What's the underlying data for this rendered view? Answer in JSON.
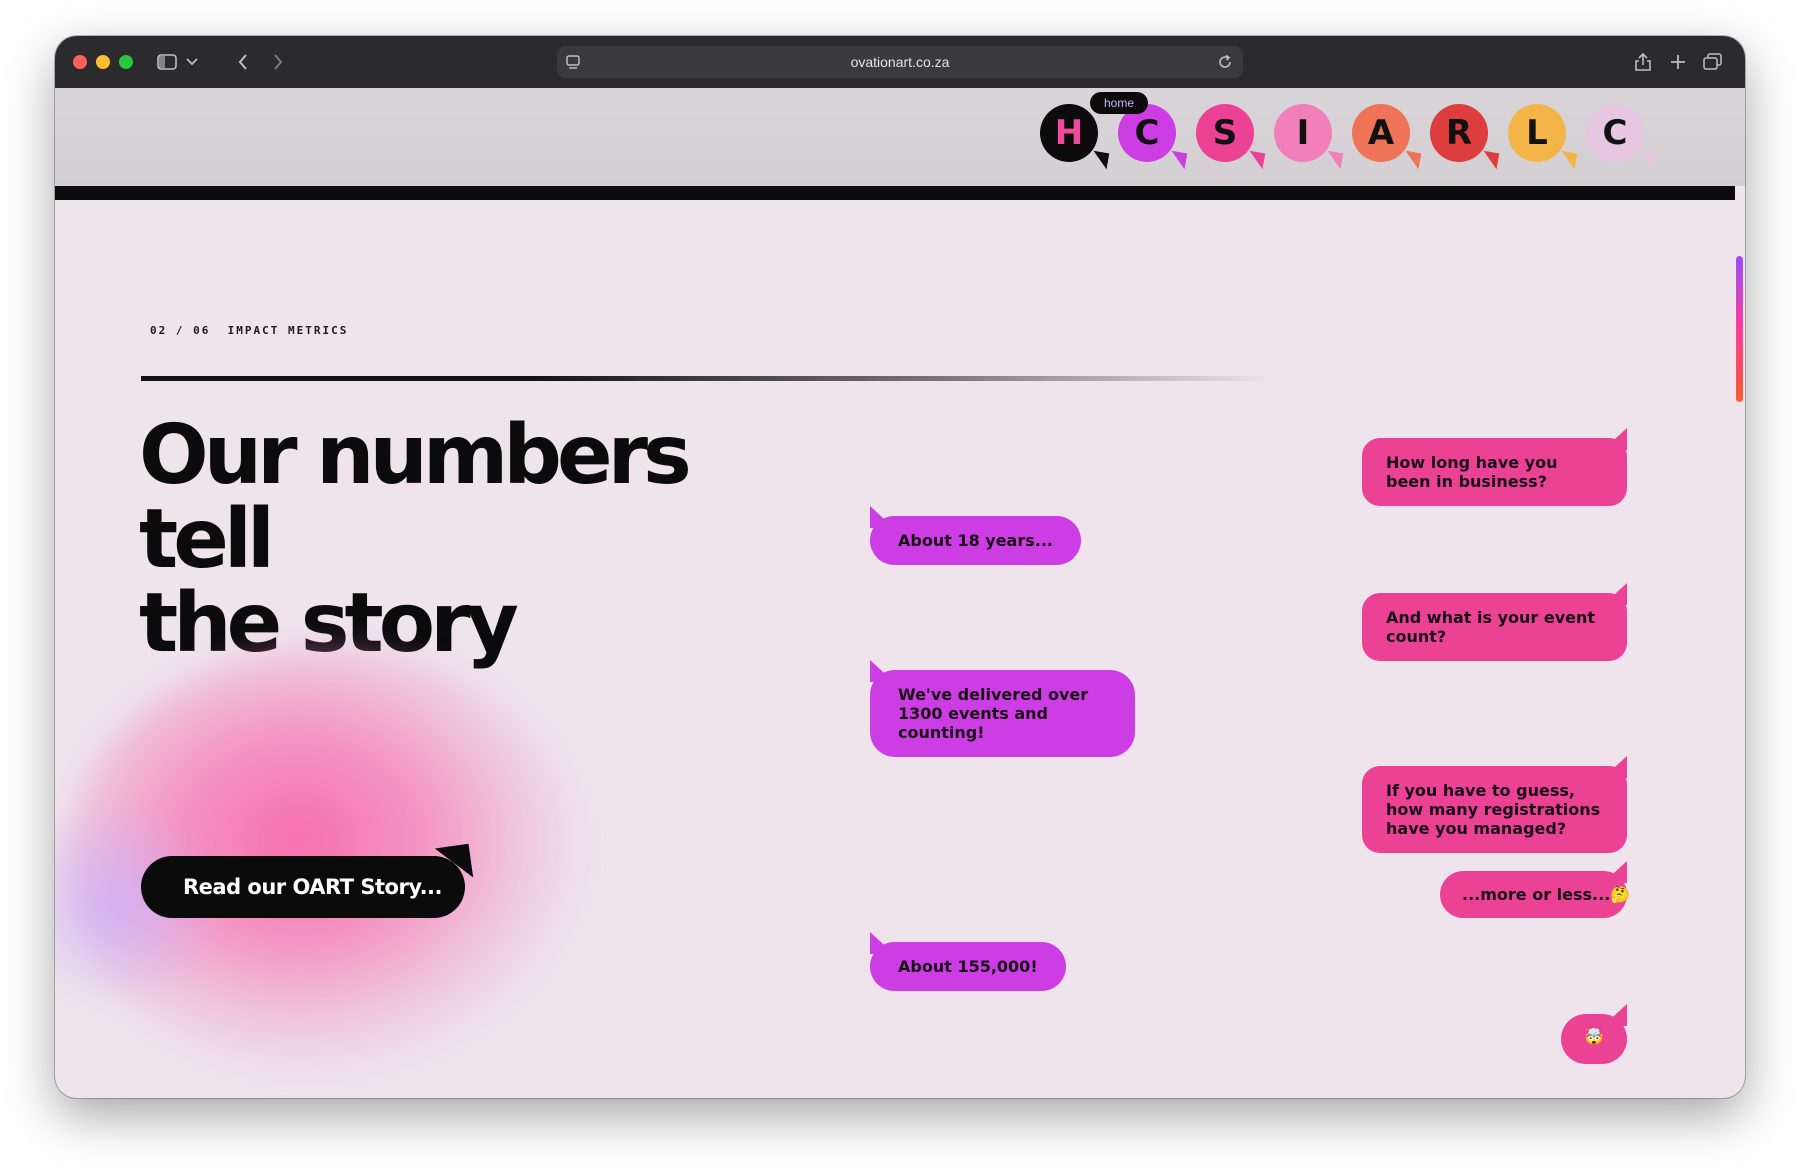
{
  "browser": {
    "url": "ovationart.co.za"
  },
  "nav": {
    "tooltip": "home",
    "items": [
      {
        "letter": "H",
        "color": "#0b0b0b",
        "text_color": "#f04a9c"
      },
      {
        "letter": "C",
        "color": "#cc3ee3",
        "text_color": "#111111"
      },
      {
        "letter": "S",
        "color": "#eb4296",
        "text_color": "#111111"
      },
      {
        "letter": "I",
        "color": "#f17fb9",
        "text_color": "#111111"
      },
      {
        "letter": "A",
        "color": "#ee7357",
        "text_color": "#111111"
      },
      {
        "letter": "R",
        "color": "#de3d3d",
        "text_color": "#111111"
      },
      {
        "letter": "L",
        "color": "#f4b548",
        "text_color": "#111111"
      },
      {
        "letter": "C",
        "color": "#e6c6e0",
        "text_color": "#111111"
      }
    ]
  },
  "section": {
    "label": "02 / 06  IMPACT METRICS",
    "headline_line1": "Our numbers tell",
    "headline_line2": "the story",
    "cta_label": "Read our OART Story..."
  },
  "chat": {
    "q1": "How long have you been in business?",
    "a1": "About 18 years...",
    "q2": "And what is your event count?",
    "a2": "We've delivered over 1300 events and counting!",
    "q3": "If you have to guess, how many registrations have you managed?",
    "q3b": "...more or less...🤔",
    "a3": "About 155,000!",
    "emoji": "🤯"
  },
  "colors": {
    "background": "#efe3ec",
    "purple_bubble": "#cc3ee3",
    "pink_bubble": "#eb4296",
    "dark": "#0b0b0b"
  }
}
